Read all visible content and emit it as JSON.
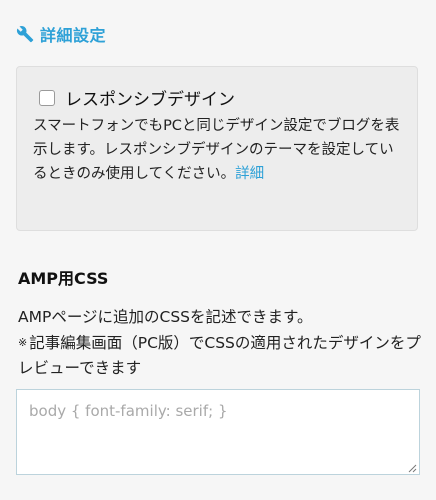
{
  "section": {
    "title": "詳細設定",
    "icon": "wrench-icon",
    "accent_color": "#2ea1d7"
  },
  "responsive": {
    "checkbox_label": "レスポンシブデザイン",
    "checked": false,
    "description": "スマートフォンでもPCと同じデザイン設定でブログを表示します。レスポンシブデザインのテーマを設定しているときのみ使用してください。",
    "detail_link": "詳細"
  },
  "amp_css": {
    "title": "AMP用CSS",
    "description_line1": "AMPページに追加のCSSを記述できます。",
    "note_mark": "※",
    "description_line2": "記事編集画面（PC版）でCSSの適用されたデザインをプレビューできます",
    "placeholder": "body { font-family: serif; }",
    "value": ""
  }
}
